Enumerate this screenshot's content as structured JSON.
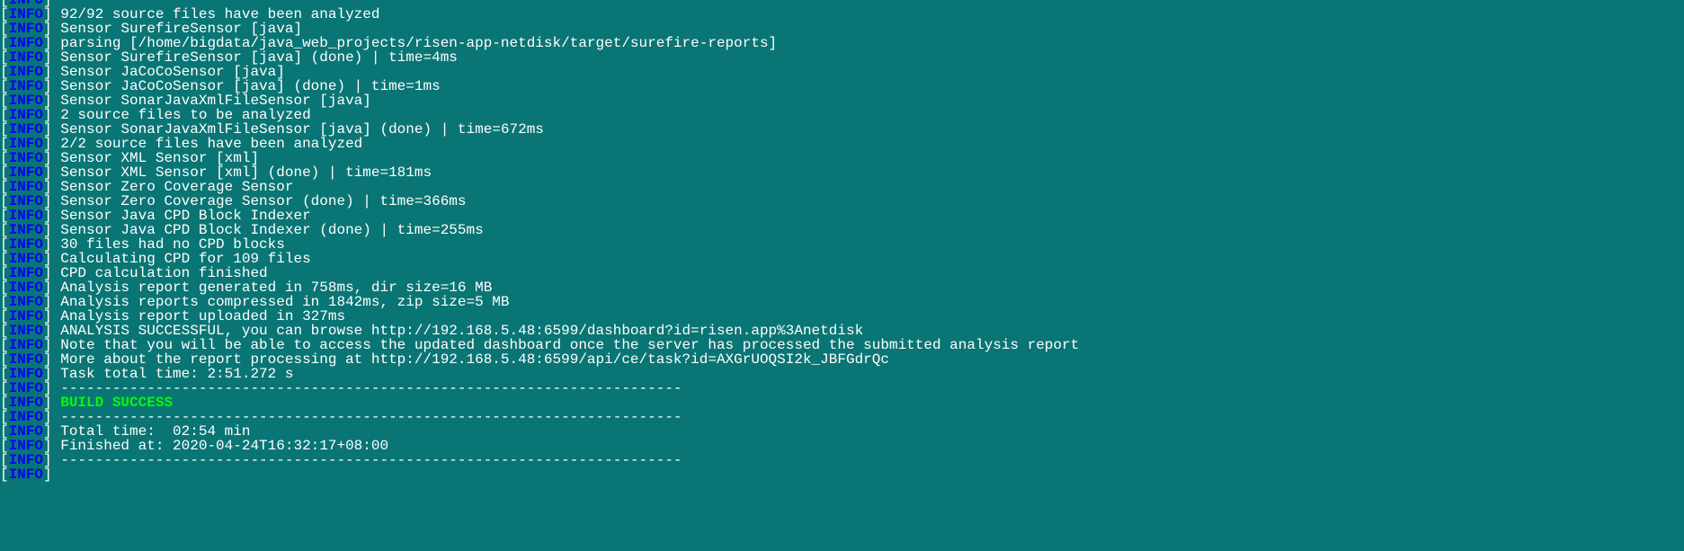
{
  "level_label": "INFO",
  "bracket_open": "[",
  "bracket_close": "]",
  "lines": [
    {
      "msg": "92/92 source files have been analyzed"
    },
    {
      "msg": "Sensor SurefireSensor [java]"
    },
    {
      "msg": "parsing [/home/bigdata/java_web_projects/risen-app-netdisk/target/surefire-reports]"
    },
    {
      "msg": "Sensor SurefireSensor [java] (done) | time=4ms"
    },
    {
      "msg": "Sensor JaCoCoSensor [java]"
    },
    {
      "msg": "Sensor JaCoCoSensor [java] (done) | time=1ms"
    },
    {
      "msg": "Sensor SonarJavaXmlFileSensor [java]"
    },
    {
      "msg": "2 source files to be analyzed"
    },
    {
      "msg": "Sensor SonarJavaXmlFileSensor [java] (done) | time=672ms"
    },
    {
      "msg": "2/2 source files have been analyzed"
    },
    {
      "msg": "Sensor XML Sensor [xml]"
    },
    {
      "msg": "Sensor XML Sensor [xml] (done) | time=181ms"
    },
    {
      "msg": "Sensor Zero Coverage Sensor"
    },
    {
      "msg": "Sensor Zero Coverage Sensor (done) | time=366ms"
    },
    {
      "msg": "Sensor Java CPD Block Indexer"
    },
    {
      "msg": "Sensor Java CPD Block Indexer (done) | time=255ms"
    },
    {
      "msg": "30 files had no CPD blocks"
    },
    {
      "msg": "Calculating CPD for 109 files"
    },
    {
      "msg": "CPD calculation finished"
    },
    {
      "msg": "Analysis report generated in 758ms, dir size=16 MB"
    },
    {
      "msg": "Analysis reports compressed in 1842ms, zip size=5 MB"
    },
    {
      "msg": "Analysis report uploaded in 327ms"
    },
    {
      "msg": "ANALYSIS SUCCESSFUL, you can browse http://192.168.5.48:6599/dashboard?id=risen.app%3Anetdisk"
    },
    {
      "msg": "Note that you will be able to access the updated dashboard once the server has processed the submitted analysis report"
    },
    {
      "msg": "More about the report processing at http://192.168.5.48:6599/api/ce/task?id=AXGrUOQSI2k_JBFGdrQc"
    },
    {
      "msg": "Task total time: 2:51.272 s"
    },
    {
      "msg": "------------------------------------------------------------------------"
    },
    {
      "msg": "BUILD SUCCESS",
      "class": "success"
    },
    {
      "msg": "------------------------------------------------------------------------"
    },
    {
      "msg": "Total time:  02:54 min"
    },
    {
      "msg": "Finished at: 2020-04-24T16:32:17+08:00"
    },
    {
      "msg": "------------------------------------------------------------------------"
    }
  ]
}
